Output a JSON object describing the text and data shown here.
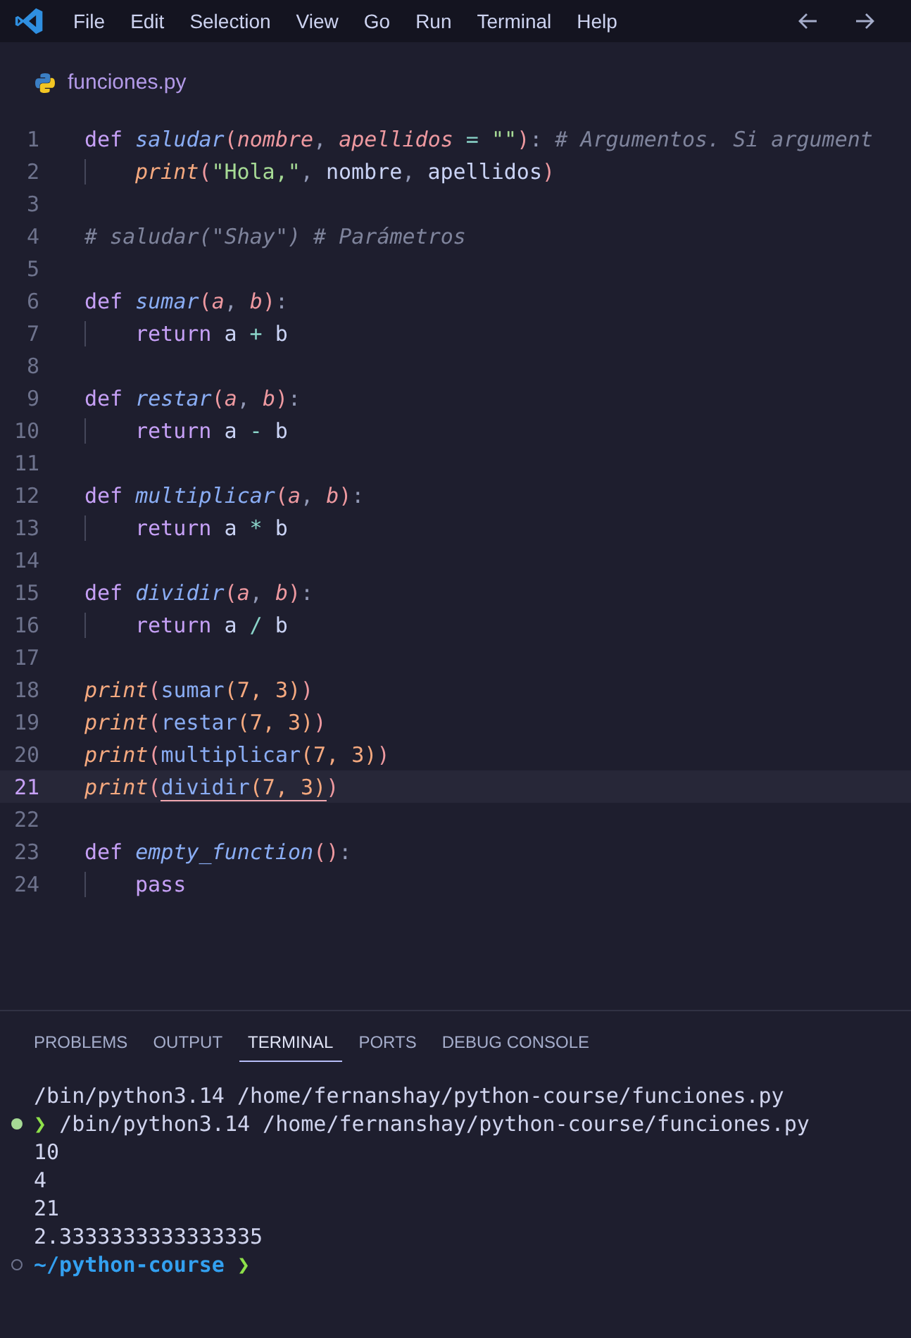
{
  "menu_bar": {
    "items": [
      "File",
      "Edit",
      "Selection",
      "View",
      "Go",
      "Run",
      "Terminal",
      "Help"
    ]
  },
  "editor_tab": {
    "label": "funciones.py"
  },
  "editor": {
    "lines": [
      {
        "number": "1",
        "current": false,
        "tokens": [
          {
            "kind": "kw",
            "text": "def "
          },
          {
            "kind": "fn",
            "text": "saludar"
          },
          {
            "kind": "paren",
            "text": "("
          },
          {
            "kind": "param",
            "text": "nombre"
          },
          {
            "kind": "punct",
            "text": ", "
          },
          {
            "kind": "param",
            "text": "apellidos"
          },
          {
            "kind": "op",
            "text": " = "
          },
          {
            "kind": "str",
            "text": "\"\""
          },
          {
            "kind": "paren",
            "text": ")"
          },
          {
            "kind": "punct",
            "text": ": "
          },
          {
            "kind": "comment",
            "text": "# Argumentos. Si argument"
          }
        ]
      },
      {
        "number": "2",
        "current": false,
        "indented": true,
        "tokens": [
          {
            "kind": "builtin",
            "text": "print"
          },
          {
            "kind": "paren",
            "text": "("
          },
          {
            "kind": "str",
            "text": "\"Hola,\""
          },
          {
            "kind": "punct",
            "text": ", "
          },
          {
            "kind": "text",
            "text": "nombre"
          },
          {
            "kind": "punct",
            "text": ", "
          },
          {
            "kind": "text",
            "text": "apellidos"
          },
          {
            "kind": "paren",
            "text": ")"
          }
        ]
      },
      {
        "number": "3",
        "current": false
      },
      {
        "number": "4",
        "current": false,
        "tokens": [
          {
            "kind": "comment",
            "text": "# saludar(\"Shay\") # Parámetros"
          }
        ]
      },
      {
        "number": "5",
        "current": false
      },
      {
        "number": "6",
        "current": false,
        "tokens": [
          {
            "kind": "kw",
            "text": "def "
          },
          {
            "kind": "fn",
            "text": "sumar"
          },
          {
            "kind": "paren",
            "text": "("
          },
          {
            "kind": "param",
            "text": "a"
          },
          {
            "kind": "punct",
            "text": ", "
          },
          {
            "kind": "param",
            "text": "b"
          },
          {
            "kind": "paren",
            "text": ")"
          },
          {
            "kind": "punct",
            "text": ":"
          }
        ]
      },
      {
        "number": "7",
        "current": false,
        "indented": true,
        "tokens": [
          {
            "kind": "kw",
            "text": "return "
          },
          {
            "kind": "text",
            "text": "a "
          },
          {
            "kind": "op",
            "text": "+"
          },
          {
            "kind": "text",
            "text": " b"
          }
        ]
      },
      {
        "number": "8",
        "current": false
      },
      {
        "number": "9",
        "current": false,
        "tokens": [
          {
            "kind": "kw",
            "text": "def "
          },
          {
            "kind": "fn",
            "text": "restar"
          },
          {
            "kind": "paren",
            "text": "("
          },
          {
            "kind": "param",
            "text": "a"
          },
          {
            "kind": "punct",
            "text": ", "
          },
          {
            "kind": "param",
            "text": "b"
          },
          {
            "kind": "paren",
            "text": ")"
          },
          {
            "kind": "punct",
            "text": ":"
          }
        ]
      },
      {
        "number": "10",
        "current": false,
        "indented": true,
        "tokens": [
          {
            "kind": "kw",
            "text": "return "
          },
          {
            "kind": "text",
            "text": "a "
          },
          {
            "kind": "op",
            "text": "-"
          },
          {
            "kind": "text",
            "text": " b"
          }
        ]
      },
      {
        "number": "11",
        "current": false
      },
      {
        "number": "12",
        "current": false,
        "tokens": [
          {
            "kind": "kw",
            "text": "def "
          },
          {
            "kind": "fn",
            "text": "multiplicar"
          },
          {
            "kind": "paren",
            "text": "("
          },
          {
            "kind": "param",
            "text": "a"
          },
          {
            "kind": "punct",
            "text": ", "
          },
          {
            "kind": "param",
            "text": "b"
          },
          {
            "kind": "paren",
            "text": ")"
          },
          {
            "kind": "punct",
            "text": ":"
          }
        ]
      },
      {
        "number": "13",
        "current": false,
        "indented": true,
        "tokens": [
          {
            "kind": "kw",
            "text": "return "
          },
          {
            "kind": "text",
            "text": "a "
          },
          {
            "kind": "op",
            "text": "*"
          },
          {
            "kind": "text",
            "text": " b"
          }
        ]
      },
      {
        "number": "14",
        "current": false
      },
      {
        "number": "15",
        "current": false,
        "tokens": [
          {
            "kind": "kw",
            "text": "def "
          },
          {
            "kind": "fn",
            "text": "dividir"
          },
          {
            "kind": "paren",
            "text": "("
          },
          {
            "kind": "param",
            "text": "a"
          },
          {
            "kind": "punct",
            "text": ", "
          },
          {
            "kind": "param",
            "text": "b"
          },
          {
            "kind": "paren",
            "text": ")"
          },
          {
            "kind": "punct",
            "text": ":"
          }
        ]
      },
      {
        "number": "16",
        "current": false,
        "indented": true,
        "tokens": [
          {
            "kind": "kw",
            "text": "return "
          },
          {
            "kind": "text",
            "text": "a "
          },
          {
            "kind": "op",
            "text": "/"
          },
          {
            "kind": "text",
            "text": " b"
          }
        ]
      },
      {
        "number": "17",
        "current": false
      },
      {
        "number": "18",
        "current": false,
        "tokens": [
          {
            "kind": "builtin",
            "text": "print"
          },
          {
            "kind": "paren",
            "text": "("
          },
          {
            "kind": "call",
            "text": "sumar"
          },
          {
            "kind": "num",
            "text": "(7, 3)"
          },
          {
            "kind": "paren",
            "text": ")"
          }
        ]
      },
      {
        "number": "19",
        "current": false,
        "tokens": [
          {
            "kind": "builtin",
            "text": "print"
          },
          {
            "kind": "paren",
            "text": "("
          },
          {
            "kind": "call",
            "text": "restar"
          },
          {
            "kind": "num",
            "text": "(7, 3)"
          },
          {
            "kind": "paren",
            "text": ")"
          }
        ]
      },
      {
        "number": "20",
        "current": false,
        "tokens": [
          {
            "kind": "builtin",
            "text": "print"
          },
          {
            "kind": "paren",
            "text": "("
          },
          {
            "kind": "call",
            "text": "multiplicar"
          },
          {
            "kind": "num",
            "text": "(7, 3)"
          },
          {
            "kind": "paren",
            "text": ")"
          }
        ]
      },
      {
        "number": "21",
        "current": true,
        "tokens": [
          {
            "kind": "builtin",
            "text": "print"
          },
          {
            "kind": "paren",
            "text": "("
          },
          {
            "kind": "call",
            "text": "dividir",
            "underline": true
          },
          {
            "kind": "num",
            "text": "(7, 3)",
            "underline": true
          },
          {
            "kind": "paren",
            "text": ")"
          }
        ]
      },
      {
        "number": "22",
        "current": false
      },
      {
        "number": "23",
        "current": false,
        "tokens": [
          {
            "kind": "kw",
            "text": "def "
          },
          {
            "kind": "fn",
            "text": "empty_function"
          },
          {
            "kind": "paren",
            "text": "()"
          },
          {
            "kind": "punct",
            "text": ":"
          }
        ]
      },
      {
        "number": "24",
        "current": false,
        "indented": true,
        "tokens": [
          {
            "kind": "kw",
            "text": "pass"
          }
        ]
      }
    ]
  },
  "panel": {
    "tabs": [
      {
        "label": "PROBLEMS",
        "selected": false
      },
      {
        "label": "OUTPUT",
        "selected": false
      },
      {
        "label": "TERMINAL",
        "selected": true
      },
      {
        "label": "PORTS",
        "selected": false
      },
      {
        "label": "DEBUG CONSOLE",
        "selected": false
      }
    ],
    "terminal_lines": [
      {
        "kind": "plain",
        "text": "/bin/python3.14 /home/fernanshay/python-course/funciones.py"
      },
      {
        "kind": "command",
        "dot_filled": true,
        "chevron": "❯",
        "text": "/bin/python3.14 /home/fernanshay/python-course/funciones.py"
      },
      {
        "kind": "plain",
        "text": "10"
      },
      {
        "kind": "plain",
        "text": "4"
      },
      {
        "kind": "plain",
        "text": "21"
      },
      {
        "kind": "plain",
        "text": "2.3333333333333335"
      },
      {
        "kind": "prompt",
        "dot_filled": false,
        "text": "~/python-course",
        "chevron": "❯"
      }
    ]
  }
}
